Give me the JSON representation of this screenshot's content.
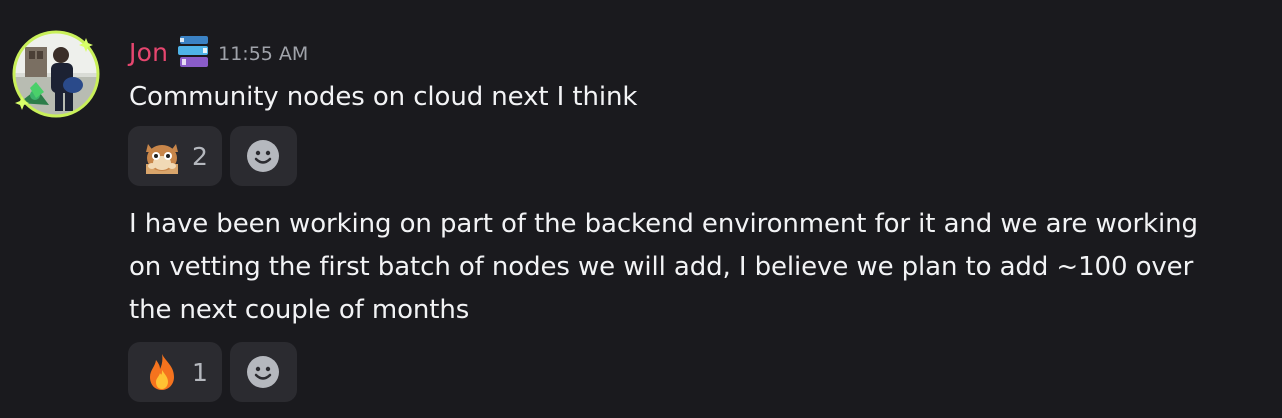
{
  "author": {
    "name": "Jon",
    "tag_icon": "books-icon",
    "timestamp": "11:55 AM",
    "name_color": "#e6466f"
  },
  "messages": [
    {
      "lines": [
        "Community nodes on cloud next I think"
      ],
      "reactions": [
        {
          "emoji": "hamster-emoji",
          "count": "2"
        }
      ]
    },
    {
      "lines": [
        "I have been working on part of the backend environment for it and we are working",
        "on vetting the first batch of nodes we will add, I believe we plan to add ~100 over",
        "the next couple of months"
      ],
      "reactions": [
        {
          "emoji": "fire-emoji",
          "count": "1"
        }
      ]
    }
  ],
  "icons": {
    "add_reaction": "smiley-add-reaction-icon"
  }
}
